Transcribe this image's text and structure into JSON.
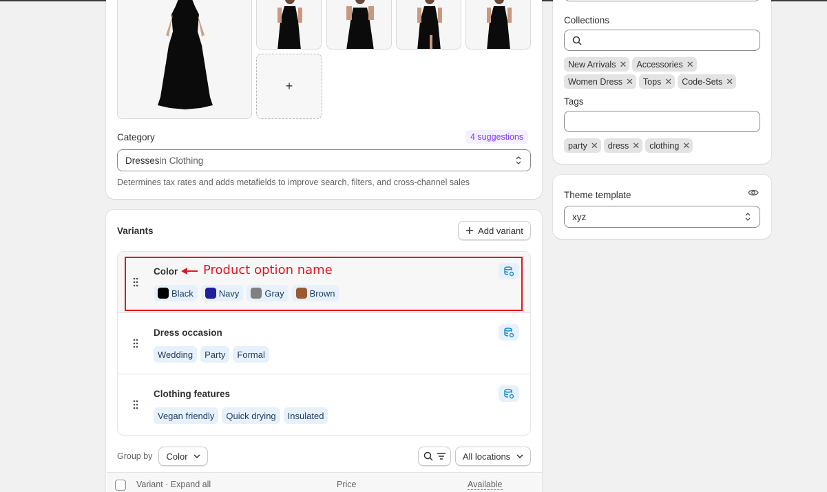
{
  "media": {
    "add_label": "+"
  },
  "category": {
    "label": "Category",
    "suggestions": "4 suggestions",
    "value_main": "Dresses",
    "value_rest": " in Clothing",
    "help": "Determines tax rates and adds metafields to improve search, filters, and cross-channel sales"
  },
  "variants": {
    "title": "Variants",
    "add_button": "Add variant",
    "options": [
      {
        "name": "Color",
        "values": [
          {
            "label": "Black",
            "color": "#000000"
          },
          {
            "label": "Navy",
            "color": "#1f1f9a"
          },
          {
            "label": "Gray",
            "color": "#808080"
          },
          {
            "label": "Brown",
            "color": "#9a5a32"
          }
        ]
      },
      {
        "name": "Dress occasion",
        "values": [
          {
            "label": "Wedding"
          },
          {
            "label": "Party"
          },
          {
            "label": "Formal"
          }
        ]
      },
      {
        "name": "Clothing features",
        "values": [
          {
            "label": "Vegan friendly"
          },
          {
            "label": "Quick drying"
          },
          {
            "label": "Insulated"
          }
        ]
      }
    ],
    "annotation": "Product option name",
    "group_by_label": "Group by",
    "group_by_value": "Color",
    "locations": "All locations",
    "table": {
      "variant_col": "Variant",
      "expand_all": "Expand all",
      "price_col": "Price",
      "available_col": "Available"
    }
  },
  "organization": {
    "collections_label": "Collections",
    "collections": [
      "New Arrivals",
      "Accessories",
      "Women Dress",
      "Tops",
      "Code-Sets"
    ],
    "tags_label": "Tags",
    "tags": [
      "party",
      "dress",
      "clothing"
    ]
  },
  "theme": {
    "label": "Theme template",
    "value": "xyz"
  },
  "colors": {
    "accent_chip": "#e7f1fb",
    "annotation_red": "#e5131b",
    "suggest_purple": "#7c3aed"
  }
}
